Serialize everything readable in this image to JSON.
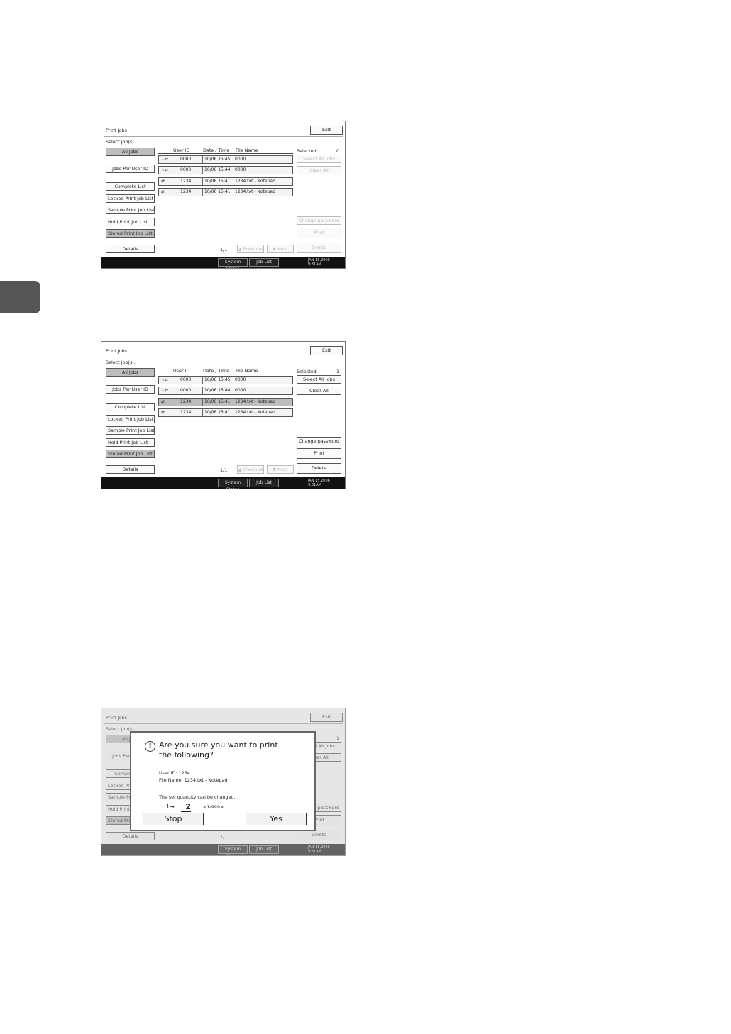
{
  "screens": [
    {
      "title": "Print Jobs",
      "exit_label": "Exit",
      "select_prompt": "Select job(s).",
      "left_buttons": [
        "All Jobs",
        "Jobs Per User ID",
        "Complete List",
        "Locked Print Job List",
        "Sample Print Job List",
        "Hold Print Job List",
        "Stored Print Job List"
      ],
      "details_label": "Details",
      "columns": [
        "User ID",
        "Date / Time",
        "File Name"
      ],
      "rows": [
        {
          "icon": "↓⇄",
          "user": "0000",
          "date": "10/06 15:45",
          "file": "0000"
        },
        {
          "icon": "↓⇄",
          "user": "0000",
          "date": "10/06 15:44",
          "file": "0000"
        },
        {
          "icon": "⇄",
          "user": "1234",
          "date": "10/06 15:41",
          "file": "1234.txt - Notepad"
        },
        {
          "icon": "⇄",
          "user": "1234",
          "date": "10/06 15:41",
          "file": "1234.txt - Notepad"
        }
      ],
      "selected_label": "Selected",
      "selected_count": "0",
      "right_buttons": [
        "Select All Jobs",
        "Clear All",
        "Change password",
        "Print",
        "Delete"
      ],
      "page": "1/1",
      "prev_label": "▲ Previous",
      "next_label": "▼ Next",
      "footer": {
        "system_status": "System Status",
        "job_list": "Job List",
        "date": "JAN 15,2006",
        "time": "9:31AM"
      }
    },
    {
      "title": "Print Jobs",
      "exit_label": "Exit",
      "select_prompt": "Select job(s).",
      "left_buttons": [
        "All Jobs",
        "Jobs Per User ID",
        "Complete List",
        "Locked Print Job List",
        "Sample Print Job List",
        "Hold Print Job List",
        "Stored Print Job List"
      ],
      "details_label": "Details",
      "columns": [
        "User ID",
        "Date / Time",
        "File Name"
      ],
      "rows": [
        {
          "icon": "↓⇄",
          "user": "0000",
          "date": "10/06 15:45",
          "file": "0000"
        },
        {
          "icon": "↓⇄",
          "user": "0000",
          "date": "10/06 15:44",
          "file": "0000"
        },
        {
          "icon": "⇄",
          "user": "1234",
          "date": "10/06 15:41",
          "file": "1234.txt - Notepad"
        },
        {
          "icon": "⇄",
          "user": "1234",
          "date": "10/06 15:41",
          "file": "1234.txt - Notepad"
        }
      ],
      "selected_label": "Selected",
      "selected_count": "1",
      "right_buttons": [
        "Select All Jobs",
        "Clear All",
        "Change password",
        "Print",
        "Delete"
      ],
      "page": "1/1",
      "prev_label": "▲ Previous",
      "next_label": "▼ Next",
      "footer": {
        "system_status": "System Status",
        "job_list": "Job List",
        "date": "JAN 15,2006",
        "time": "9:31AM"
      }
    },
    {
      "title": "Print Jobs",
      "exit_label": "Exit",
      "select_prompt": "Select job(s).",
      "left_buttons": [
        "All Jobs",
        "Jobs Per User ID",
        "Complete List",
        "Locked Print Job List",
        "Sample Print Job List",
        "Hold Print Job List",
        "Stored Print Job List"
      ],
      "details_label": "Details",
      "selected_count": "1",
      "right_buttons": [
        "Select All Jobs",
        "Clear All",
        "Change password",
        "Print",
        "Delete"
      ],
      "page": "1/1",
      "footer": {
        "system_status": "System Status",
        "job_list": "Job List",
        "date": "JAN 15,2006",
        "time": "9:31AM"
      }
    }
  ],
  "dialog": {
    "question": "Are you sure you want to print the following?",
    "user_id": "User ID: 1234",
    "file_name": "File Name: 1234.txt - Notepad",
    "note": "The set quantity can be changed.",
    "quantity_prefix": "1→",
    "quantity_value": "2",
    "quantity_range": "<1-999>",
    "stop_label": "Stop",
    "yes_label": "Yes"
  }
}
